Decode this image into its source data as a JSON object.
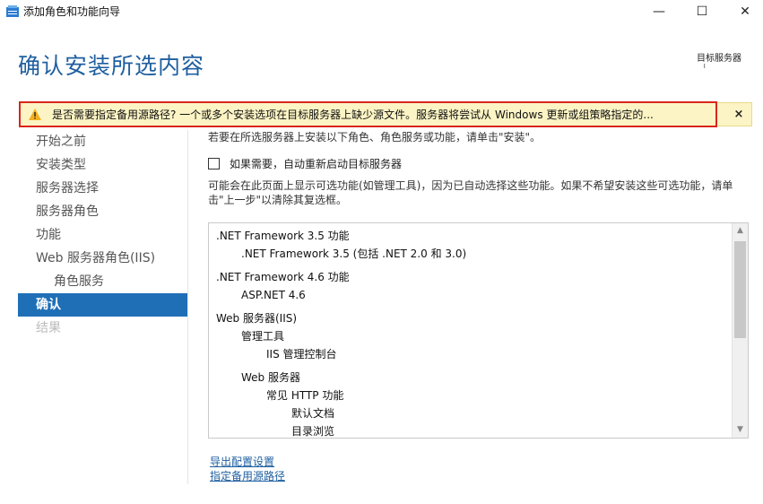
{
  "window": {
    "title": "添加角色和功能向导",
    "minimize_glyph": "—",
    "maximize_glyph": "☐",
    "close_glyph": "✕"
  },
  "header": {
    "page_title": "确认安装所选内容",
    "target_server_label": "目标服务器",
    "target_server_value": "ı"
  },
  "warning": {
    "text": "是否需要指定备用源路径? 一个或多个安装选项在目标服务器上缺少源文件。服务器将尝试从 Windows 更新或组策略指定的...",
    "close_glyph": "×",
    "icon": "warning-triangle-icon",
    "color": "#fcf4c4",
    "highlight_color": "#d9261c"
  },
  "nav": {
    "items": [
      {
        "label": "开始之前"
      },
      {
        "label": "安装类型"
      },
      {
        "label": "服务器选择"
      },
      {
        "label": "服务器角色"
      },
      {
        "label": "功能"
      },
      {
        "label": "Web 服务器角色(IIS)"
      },
      {
        "label": "角色服务"
      },
      {
        "label": "确认"
      },
      {
        "label": "结果"
      }
    ],
    "active_color": "#1f6fb7"
  },
  "main": {
    "intro": "若要在所选服务器上安装以下角色、角色服务或功能，请单击\"安装\"。",
    "restart_label": "如果需要，自动重新启动目标服务器",
    "restart_checked": false,
    "note": "可能会在此页面上显示可选功能(如管理工具)，因为已自动选择这些功能。如果不希望安装这些可选功能，请单击\"上一步\"以清除其复选框。",
    "features": [
      {
        "label": ".NET Framework 3.5 功能"
      },
      {
        "label": ".NET Framework 3.5 (包括 .NET 2.0 和 3.0)"
      },
      {
        "label": ".NET Framework 4.6 功能"
      },
      {
        "label": "ASP.NET 4.6"
      },
      {
        "label": "Web 服务器(IIS)"
      },
      {
        "label": "管理工具"
      },
      {
        "label": "IIS 管理控制台"
      },
      {
        "label": "Web 服务器"
      },
      {
        "label": "常见 HTTP 功能"
      },
      {
        "label": "默认文档"
      },
      {
        "label": "目录浏览"
      }
    ],
    "links": {
      "export": "导出配置设置",
      "alt_source": "指定备用源路径"
    }
  }
}
